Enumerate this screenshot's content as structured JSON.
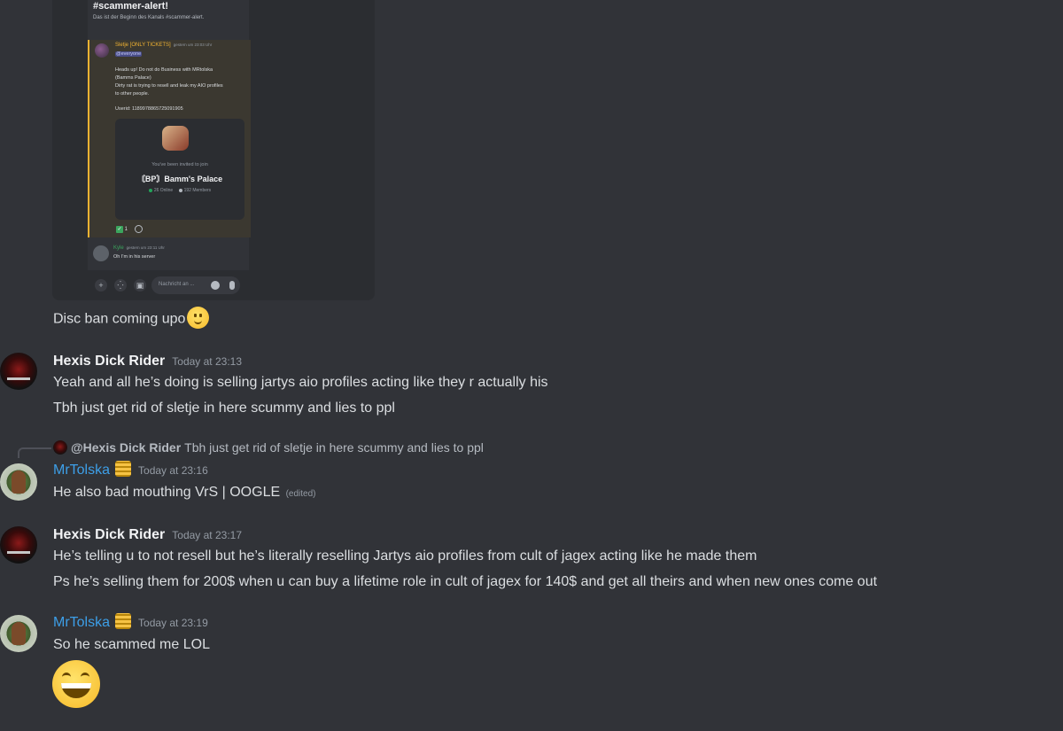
{
  "attachment": {
    "channel_title": "#scammer-alert!",
    "channel_subtitle": "Das ist der Beginn des Kanals #scammer-alert.",
    "message": {
      "author": "Sletje [ONLY TICKETS]",
      "timestamp": "gestern um 23:03 Uhr",
      "mention": "@everyone",
      "lines": [
        "Heads up! Do not do Business with MRtolska",
        "(Bamms Palace)",
        "Dirty rat is trying to resell and leak my AIO profiles",
        "to other people.",
        "Userid: 1189978865725091905"
      ],
      "invite": {
        "lead": "You've been invited to join",
        "server_name": "〘BP〙Bamm's Palace",
        "online": "26 Online",
        "members": "192 Members"
      },
      "reaction_count": "1"
    },
    "reply": {
      "author": "Kyle",
      "timestamp": "gestern um 23:11 Uhr",
      "text": "Oh I'm in his server"
    },
    "input_placeholder": "Nachricht an ..."
  },
  "messages": {
    "disc_ban": "Disc ban coming upo",
    "m1": {
      "author": "Hexis Dick Rider",
      "timestamp": "Today at 23:13",
      "lines": [
        "Yeah and all he’s doing is selling jartys aio profiles acting like they r actually his",
        "Tbh just get rid of sletje in here scummy and lies to ppl"
      ]
    },
    "m2": {
      "reply_author": "@Hexis Dick Rider",
      "reply_text": "Tbh just get rid of sletje in here scummy and lies to ppl",
      "author": "MrTolska",
      "timestamp": "Today at 23:16",
      "text": "He also bad mouthing VrS | OOGLE",
      "edited": "(edited)"
    },
    "m3": {
      "author": "Hexis Dick Rider",
      "timestamp": "Today at 23:17",
      "lines": [
        "He’s telling u to not resell but he’s literally reselling Jartys aio profiles from cult of jagex acting like he made them",
        "Ps he’s selling them for 200$ when u can buy a lifetime role in cult of jagex for 140$ and get all theirs and when new ones come out"
      ]
    },
    "m4": {
      "author": "MrTolska",
      "timestamp": "Today at 23:19",
      "text": "So he scammed me LOL"
    }
  },
  "icons": {
    "slight-smile": "slightly-smiling-face-emoji",
    "grin": "grinning-face-with-smiling-eyes-emoji",
    "coins": "coins-emoji"
  },
  "colors": {
    "background": "#313338",
    "username_blue": "#3d9fe8",
    "mention_highlight": "#f0b232"
  }
}
